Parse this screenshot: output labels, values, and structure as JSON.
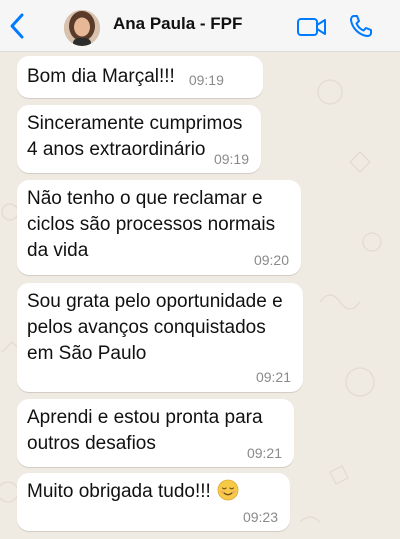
{
  "header": {
    "contact_name": "Ana Paula - FPF",
    "icons": {
      "back": "chevron-left-icon",
      "video": "video-camera-icon",
      "call": "phone-icon"
    },
    "accent_color": "#007aff"
  },
  "messages": [
    {
      "text": "Bom dia Marçal!!!",
      "time": "09:19"
    },
    {
      "text": "Sinceramente cumprimos 4 anos extraordinário",
      "time": "09:19"
    },
    {
      "text": "Não tenho o que reclamar e ciclos são processos normais da vida",
      "time": "09:20"
    },
    {
      "text": "Sou grata pelo oportunidade e pelos avanços conquistados em São Paulo",
      "time": "09:21"
    },
    {
      "text": "Aprendi e estou pronta para outros desafios",
      "time": "09:21"
    },
    {
      "text": "Muito obrigada tudo!!!",
      "emoji": "relieved-face-emoji",
      "time": "09:23"
    }
  ],
  "colors": {
    "chat_background": "#efeae2",
    "bubble": "#ffffff",
    "timestamp": "#8a8a8a"
  }
}
